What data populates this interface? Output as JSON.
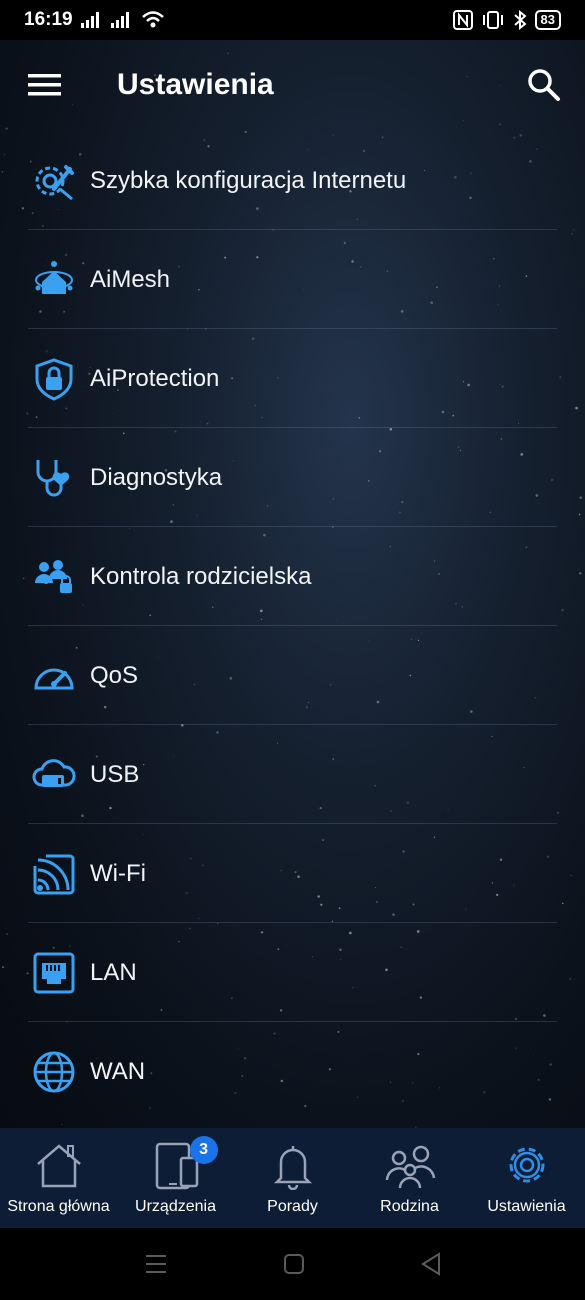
{
  "status_bar": {
    "time": "16:19",
    "battery": "83",
    "icons": [
      "signal-icon",
      "signal-icon",
      "wifi-icon",
      "nfc-icon",
      "vibrate-icon",
      "bluetooth-icon",
      "battery-icon"
    ]
  },
  "header": {
    "title": "Ustawienia"
  },
  "menu": {
    "items": [
      {
        "label": "Szybka konfiguracja Internetu",
        "icon": "gear-wrench-icon"
      },
      {
        "label": "AiMesh",
        "icon": "mesh-house-icon"
      },
      {
        "label": "AiProtection",
        "icon": "shield-lock-icon"
      },
      {
        "label": "Diagnostyka",
        "icon": "stethoscope-icon"
      },
      {
        "label": "Kontrola rodzicielska",
        "icon": "family-lock-icon"
      },
      {
        "label": "QoS",
        "icon": "speedometer-icon"
      },
      {
        "label": "USB",
        "icon": "cloud-usb-icon"
      },
      {
        "label": "Wi-Fi",
        "icon": "wifi-square-icon"
      },
      {
        "label": "LAN",
        "icon": "lan-port-icon"
      },
      {
        "label": "WAN",
        "icon": "globe-icon"
      }
    ]
  },
  "bottom_nav": {
    "items": [
      {
        "label": "Strona główna",
        "icon": "home-icon"
      },
      {
        "label": "Urządzenia",
        "icon": "devices-icon",
        "badge": "3"
      },
      {
        "label": "Porady",
        "icon": "bell-icon"
      },
      {
        "label": "Rodzina",
        "icon": "family-icon"
      },
      {
        "label": "Ustawienia",
        "icon": "settings-gear-icon",
        "active": true
      }
    ]
  },
  "colors": {
    "accent": "#3aa0f0",
    "nav_active": "#2f8de4",
    "nav_inactive": "#9aa3b5",
    "bottom_nav_bg": "#0e1d36"
  }
}
